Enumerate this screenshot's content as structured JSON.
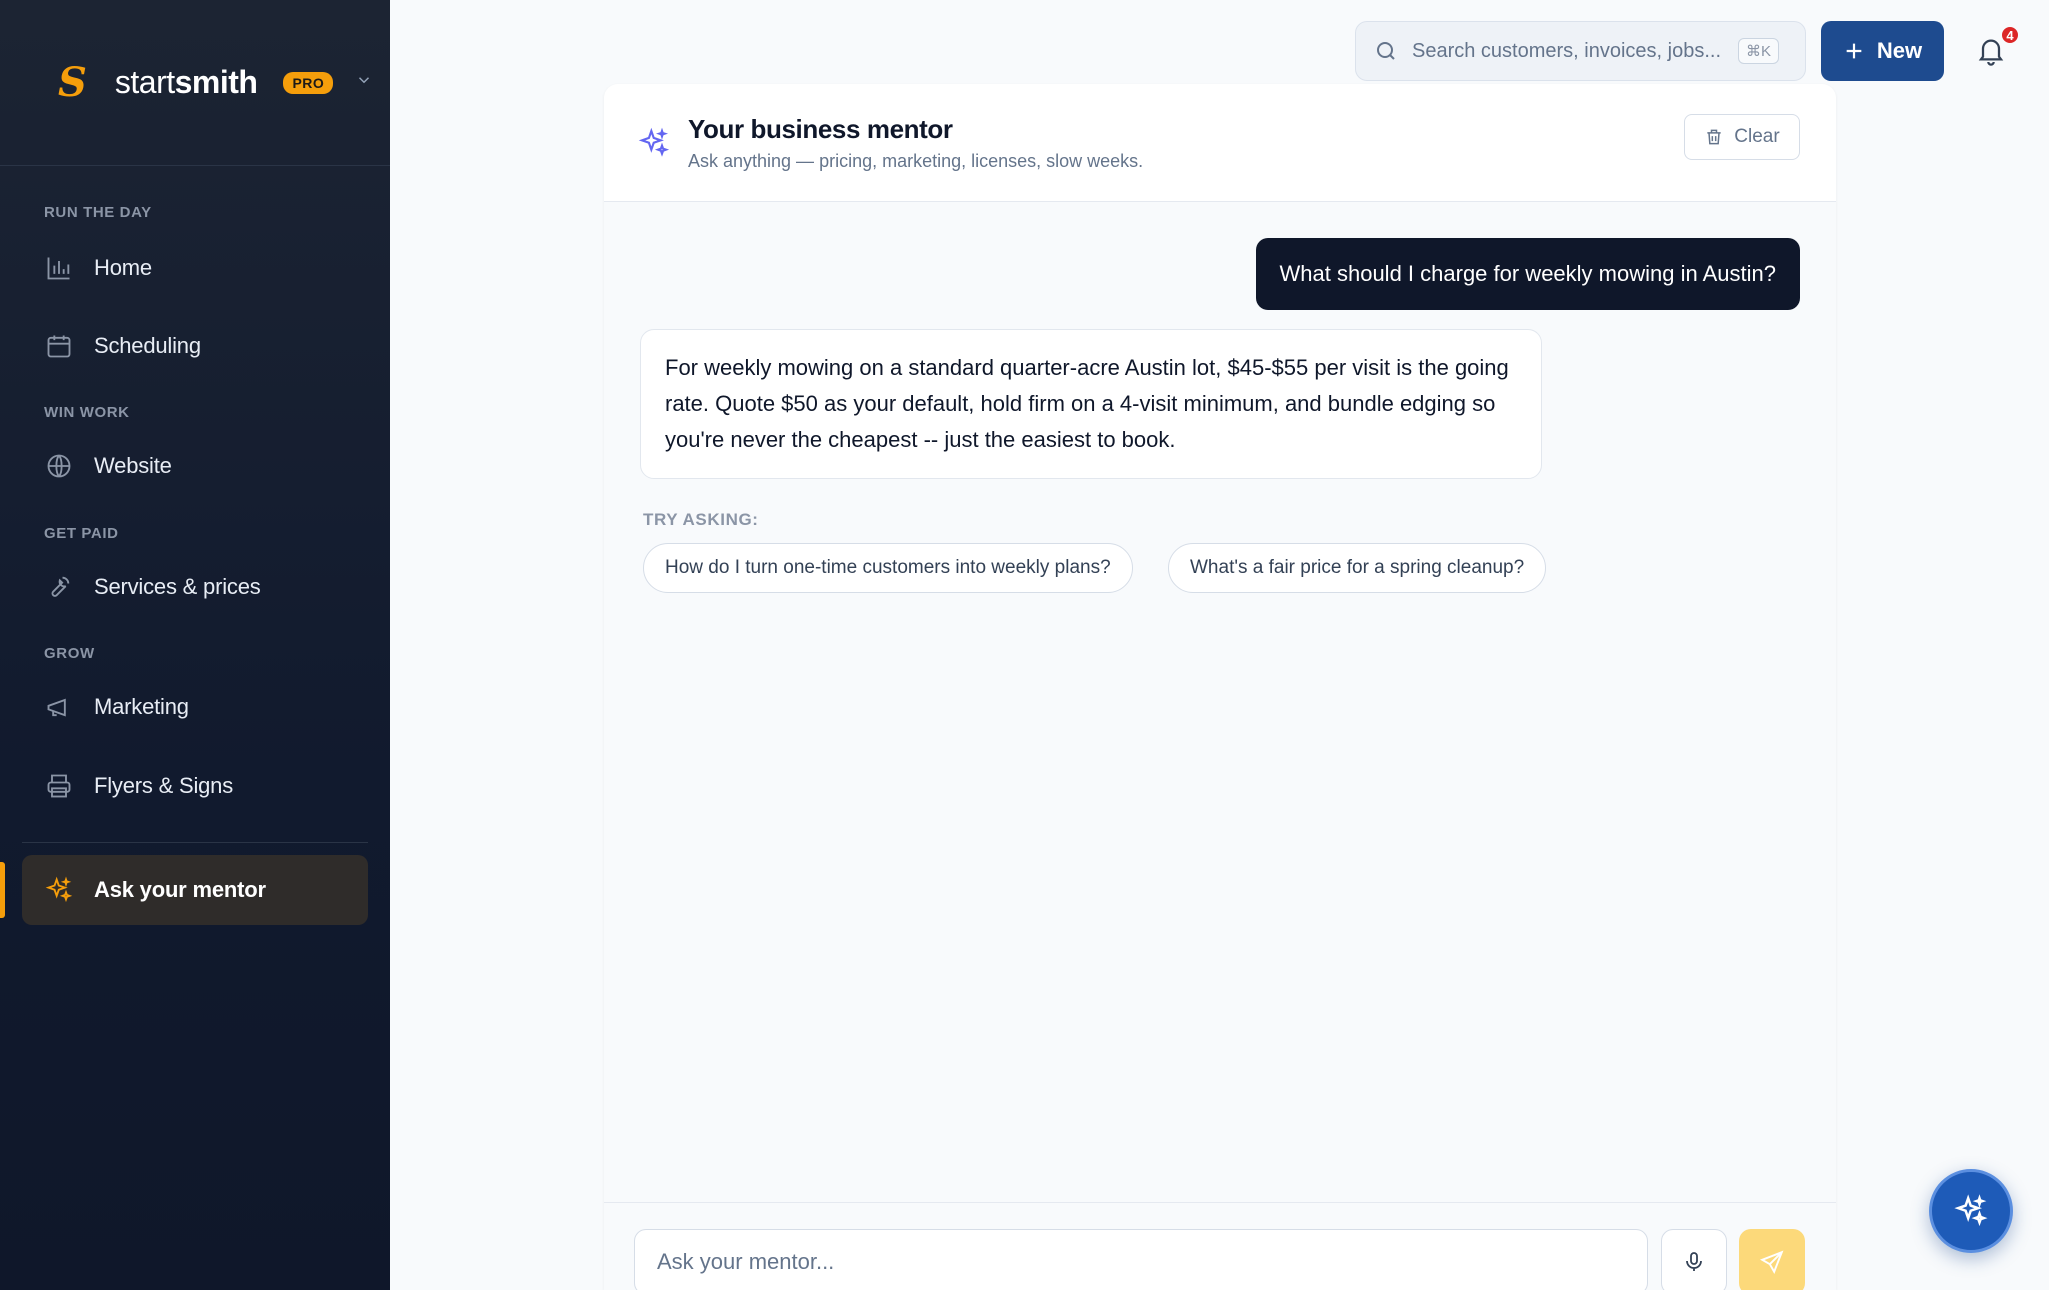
{
  "brand": {
    "mark": "S",
    "name_light": "start",
    "name_bold": "smith",
    "badge": "PRO"
  },
  "sidebar": {
    "sections": [
      {
        "label": "RUN THE DAY"
      },
      {
        "label": "WIN WORK"
      },
      {
        "label": "GET PAID"
      },
      {
        "label": "GROW"
      }
    ],
    "items": [
      {
        "label": "Home",
        "icon": "bar-chart-icon"
      },
      {
        "label": "Scheduling",
        "icon": "calendar-icon"
      },
      {
        "label": "Website",
        "icon": "globe-icon"
      },
      {
        "label": "Services & prices",
        "icon": "wrench-icon"
      },
      {
        "label": "Marketing",
        "icon": "megaphone-icon"
      },
      {
        "label": "Flyers & Signs",
        "icon": "printer-icon"
      },
      {
        "label": "Ask your mentor",
        "icon": "sparkle-icon",
        "active": true
      }
    ]
  },
  "topbar": {
    "search_placeholder": "Search customers, invoices, jobs...",
    "search_shortcut": "⌘K",
    "new_label": "New",
    "notification_count": "4"
  },
  "chat": {
    "title": "Your business mentor",
    "subtitle": "Ask anything — pricing, marketing, licenses, slow weeks.",
    "clear_label": "Clear",
    "user_message": "What should I charge for weekly mowing in Austin?",
    "assistant_message": "For weekly mowing on a standard quarter-acre Austin lot, $45-$55 per visit is the going rate. Quote $50 as your default, hold firm on a 4-visit minimum, and bundle edging so you're never the cheapest -- just the easiest to book.",
    "try_label": "TRY ASKING:",
    "suggestions": [
      "How do I turn one-time customers into weekly plans?",
      "What's a fair price for a spring cleanup?"
    ],
    "composer_placeholder": "Ask your mentor..."
  },
  "colors": {
    "accent": "#f59e0b",
    "primary": "#1e4b8f",
    "sidebar_bg": "#111a2e",
    "user_bubble": "#0f172a"
  }
}
